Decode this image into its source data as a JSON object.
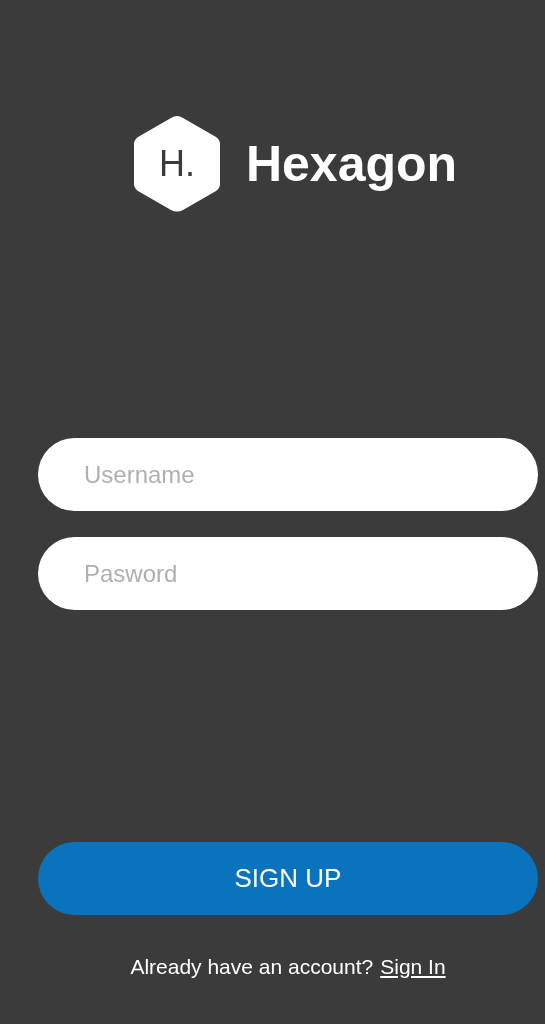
{
  "logo": {
    "mark": "H.",
    "name": "Hexagon"
  },
  "fields": [
    {
      "placeholder": "Username"
    },
    {
      "placeholder": "Pasword"
    }
  ],
  "submit": {
    "label": "SIGN UP"
  },
  "footer": {
    "text": "Already have an account?",
    "link": "Sign In"
  }
}
